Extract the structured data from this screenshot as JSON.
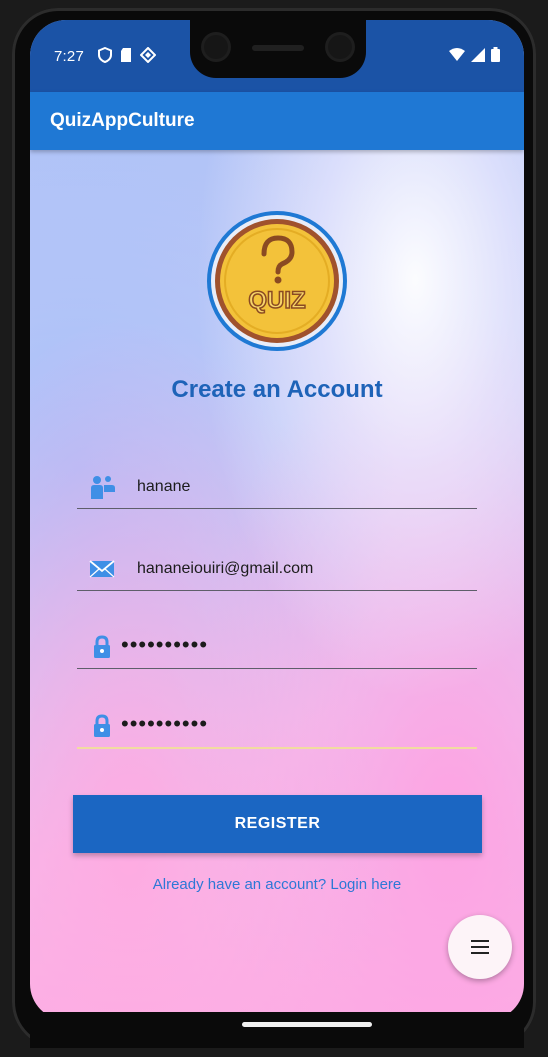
{
  "status_bar": {
    "time": "7:27"
  },
  "app_bar": {
    "title": "QuizAppCulture"
  },
  "logo": {
    "text": "QUIZ"
  },
  "page": {
    "title": "Create an Account"
  },
  "form": {
    "username": "hanane",
    "email": "hananeiouiri@gmail.com",
    "password": "••••••••••",
    "confirm_password": "••••••••••"
  },
  "actions": {
    "register_label": "REGISTER",
    "login_link": "Already have an account? Login here"
  },
  "colors": {
    "status_bar": "#1b53a6",
    "app_bar": "#1f78d4",
    "accent": "#1b66c2",
    "title": "#1e63b8",
    "link": "#2d78d6"
  },
  "icons": {
    "user": "users-icon",
    "email": "email-icon",
    "password": "lock-icon",
    "fab": "menu-icon"
  }
}
